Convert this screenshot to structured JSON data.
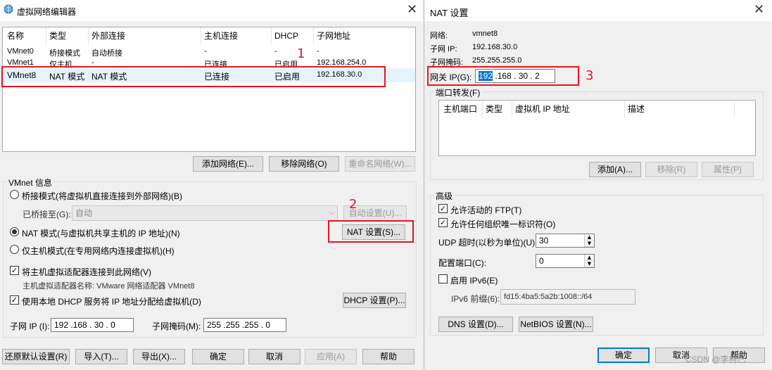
{
  "left_window": {
    "title": "虚拟网络编辑器",
    "icon": "globe-network-icon",
    "close_glyph": "✕",
    "table": {
      "headers": [
        "名称",
        "类型",
        "外部连接",
        "主机连接",
        "DHCP",
        "子网地址"
      ],
      "rows": [
        [
          "VMnet0",
          "桥接模式",
          "自动桥接",
          "-",
          "-",
          "-"
        ],
        [
          "VMnet1",
          "仅主机...",
          "-",
          "已连接",
          "已启用",
          "192.168.254.0"
        ],
        [
          "VMnet8",
          "NAT 模式",
          "NAT 模式",
          "已连接",
          "已启用",
          "192.168.30.0"
        ]
      ]
    },
    "buttons": {
      "add_network": "添加网络(E)...",
      "remove_network": "移除网络(O)",
      "rename_network": "重命名网络(W)..."
    },
    "vmnet_info": {
      "group_label": "VMnet 信息",
      "bridged_mode": "桥接模式(将虚拟机直接连接到外部网络)(B)",
      "bridged_to_label": "已桥接至(G):",
      "bridged_to_value": "自动",
      "auto_settings": "自动设置(U)...",
      "nat_mode": "NAT 模式(与虚拟机共享主机的 IP 地址)(N)",
      "nat_settings": "NAT 设置(S)...",
      "host_only_mode": "仅主机模式(在专用网络内连接虚拟机)(H)",
      "connect_adapter": "将主机虚拟适配器连接到此网络(V)",
      "adapter_name": "主机虚拟适配器名称: VMware 网络适配器 VMnet8",
      "use_dhcp": "使用本地 DHCP 服务将 IP 地址分配给虚拟机(D)",
      "dhcp_settings": "DHCP 设置(P)...",
      "subnet_ip_label": "子网 IP (I):",
      "subnet_ip_value": "192 .168 . 30 . 0",
      "subnet_mask_label": "子网掩码(M):",
      "subnet_mask_value": "255 .255 .255 . 0"
    },
    "footer": {
      "restore_defaults": "还原默认设置(R)",
      "import": "导入(T)...",
      "export": "导出(X)...",
      "ok": "确定",
      "cancel": "取消",
      "apply": "应用(A)",
      "help": "帮助"
    }
  },
  "nat_window": {
    "title": "NAT 设置",
    "close_glyph": "✕",
    "network_label": "网络:",
    "network_value": "vmnet8",
    "subnet_ip_label": "子网 IP:",
    "subnet_ip_value": "192.168.30.0",
    "subnet_mask_label": "子网掩码:",
    "subnet_mask_value": "255.255.255.0",
    "gateway_label": "网关 IP(G):",
    "gateway_selected": "192",
    "gateway_rest": " .168 . 30 . 2",
    "port_forwarding": {
      "group_label": "端口转发(F)",
      "headers": [
        "主机端口",
        "类型",
        "虚拟机 IP 地址",
        "描述"
      ],
      "add": "添加(A)...",
      "remove": "移除(R)",
      "properties": "属性(P)"
    },
    "advanced": {
      "group_label": "高级",
      "allow_ftp": "允许活动的 FTP(T)",
      "allow_any_oui": "允许任何组织唯一标识符(O)",
      "udp_timeout_label": "UDP 超时(以秒为单位)(U):",
      "udp_timeout_value": "30",
      "config_port_label": "配置端口(C):",
      "config_port_value": "0",
      "enable_ipv6": "启用 IPv6(E)",
      "ipv6_prefix_label": "IPv6 前缀(6):",
      "ipv6_prefix_value": "fd15:4ba5:5a2b:1008::/64"
    },
    "dns_settings": "DNS 设置(D)...",
    "netbios_settings": "NetBIOS 设置(N)...",
    "ok": "确定",
    "cancel": "取消",
    "help": "帮助"
  },
  "annotations": {
    "n1": "1",
    "n2": "2",
    "n3": "3"
  },
  "watermark": "CSDN @李柯已",
  "colors": {
    "annotation_red": "#e8141e",
    "selection_blue": "#0078d7"
  }
}
